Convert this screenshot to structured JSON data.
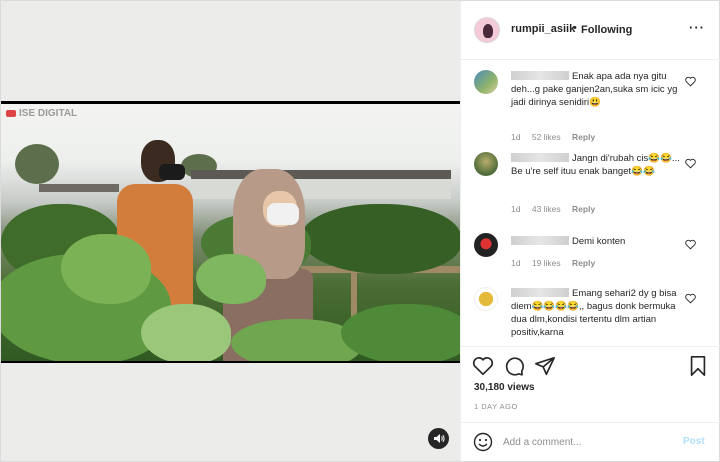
{
  "post": {
    "username": "rumpii_asiik",
    "separator": "•",
    "follow_status": "Following",
    "more_label": "···"
  },
  "video": {
    "watermark": "ISE DIGITAL"
  },
  "comments": [
    {
      "text": "Enak apa ada nya gitu deh...g pake ganjen2an,suka sm icic yg jadi dirinya senidiri😃",
      "time": "1d",
      "likes": "52 likes",
      "reply": "Reply"
    },
    {
      "text": "Jangn di'rubah cis😂😂... Be u're self ituu enak banget😂😂",
      "time": "1d",
      "likes": "43 likes",
      "reply": "Reply"
    },
    {
      "text": "Demi konten",
      "time": "1d",
      "likes": "19 likes",
      "reply": "Reply"
    },
    {
      "text": "Emang sehari2 dy g bisa diem😂😂😂😂,, bagus donk bermuka dua dlm,kondisi tertentu dlm artian positiv,karna",
      "time": "",
      "likes": "",
      "reply": ""
    }
  ],
  "stats": {
    "views": "30,180 views",
    "date": "1 DAY AGO"
  },
  "add_comment": {
    "placeholder": "Add a comment...",
    "post_label": "Post"
  },
  "colors": {
    "link_disabled": "#b2dffc",
    "meta_gray": "#8e8e8e",
    "text": "#262626",
    "border": "#dbdbdb"
  }
}
